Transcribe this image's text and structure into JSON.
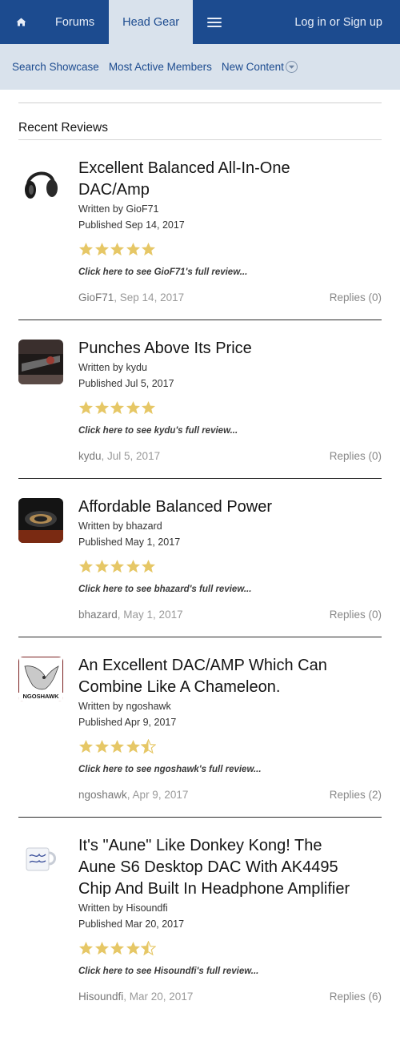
{
  "nav": {
    "home_icon": "home-icon",
    "forums": "Forums",
    "head_gear": "Head Gear",
    "menu_icon": "hamburger-menu-icon",
    "login": "Log in or Sign up"
  },
  "subnav": {
    "search_showcase": "Search Showcase",
    "most_active": "Most Active Members",
    "new_content": "New Content"
  },
  "section_title": "Recent Reviews",
  "colors": {
    "nav_bg": "#1c4b8f",
    "subnav_bg": "#d9e2ec",
    "star": "#e6c766"
  },
  "reviews": [
    {
      "title_lines": [
        "Excellent Balanced All-In-One",
        "DAC/Amp"
      ],
      "written_by": "Written by GioF71",
      "published": "Published Sep 14, 2017",
      "rating": 5,
      "cta": "Click here to see GioF71's full review...",
      "author": "GioF71",
      "date": ", Sep 14, 2017",
      "replies": "Replies (0)",
      "thumb": "headphones-thumbnail"
    },
    {
      "title_lines": [
        "Punches Above Its Price"
      ],
      "written_by": "Written by kydu",
      "published": "Published Jul 5, 2017",
      "rating": 5,
      "cta": "Click here to see kydu's full review...",
      "author": "kydu",
      "date": ", Jul 5, 2017",
      "replies": "Replies (0)",
      "thumb": "device-closeup-thumbnail"
    },
    {
      "title_lines": [
        "Affordable Balanced Power"
      ],
      "written_by": "Written by bhazard",
      "published": "Published May 1, 2017",
      "rating": 5,
      "cta": "Click here to see bhazard's full review...",
      "author": "bhazard",
      "date": ", May 1, 2017",
      "replies": "Replies (0)",
      "thumb": "device-ring-thumbnail"
    },
    {
      "title_lines": [
        "An Excellent DAC/AMP Which Can",
        "Combine Like A Chameleon."
      ],
      "written_by": "Written by ngoshawk",
      "published": "Published Apr 9, 2017",
      "rating": 4.5,
      "cta": "Click here to see ngoshawk's full review...",
      "author": "ngoshawk",
      "date": ", Apr 9, 2017",
      "replies": "Replies (2)",
      "thumb": "hawk-logo-thumbnail",
      "thumb_caption": "NGOSHAWK"
    },
    {
      "title_lines": [
        "It's \"Aune\" Like Donkey Kong! The",
        "Aune S6 Desktop DAC With AK4495",
        "Chip And Built In Headphone Amplifier"
      ],
      "written_by": "Written by Hisoundfi",
      "published": "Published Mar 20, 2017",
      "rating": 4.5,
      "cta": "Click here to see Hisoundfi's full review...",
      "author": "Hisoundfi",
      "date": ", Mar 20, 2017",
      "replies": "Replies (6)",
      "thumb": "mug-thumbnail"
    }
  ]
}
